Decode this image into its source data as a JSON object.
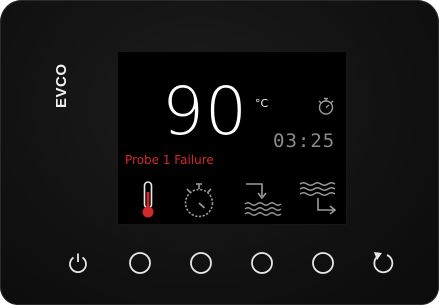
{
  "brand": {
    "name": "EVCO"
  },
  "display": {
    "temperature": "90",
    "unit": "°C",
    "time": "03:25",
    "alarm": "Probe 1 Failure"
  },
  "icons": [
    "timer-icon",
    "thermometer-icon",
    "stopwatch-icon",
    "drain-icon",
    "water-fill-icon"
  ],
  "buttons": [
    "power-button",
    "button-1",
    "button-2",
    "button-3",
    "button-4",
    "reset-button"
  ],
  "colors": {
    "alarm": "#d4282b",
    "body": "#151515",
    "screen": "#000000",
    "text": "#ffffff"
  }
}
